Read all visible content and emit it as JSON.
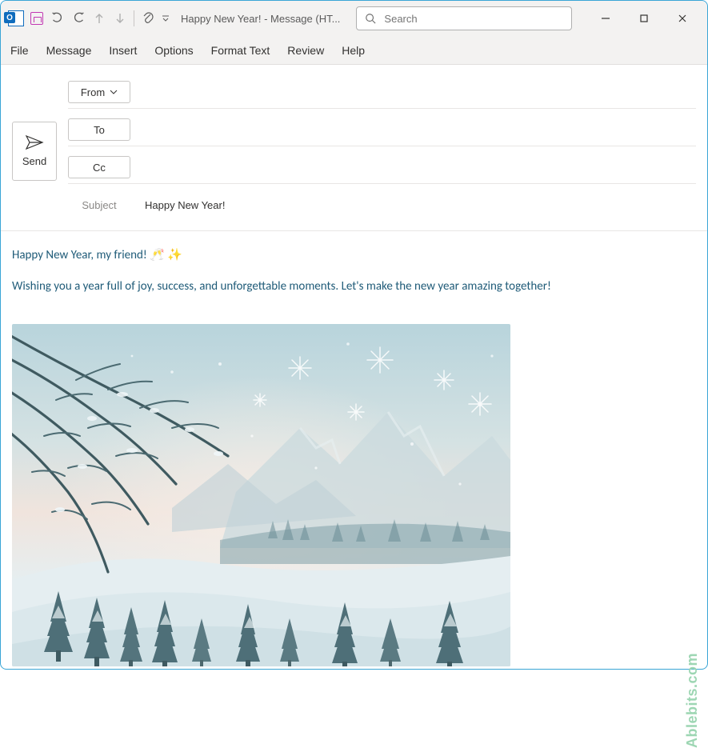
{
  "window": {
    "doc_title": "Happy New Year!  -  Message (HT..."
  },
  "search": {
    "placeholder": "Search"
  },
  "ribbon": {
    "tabs": {
      "file": "File",
      "message": "Message",
      "insert": "Insert",
      "options": "Options",
      "format_text": "Format Text",
      "review": "Review",
      "help": "Help"
    }
  },
  "compose": {
    "send_label": "Send",
    "from_label": "From",
    "to_label": "To",
    "cc_label": "Cc",
    "subject_label": "Subject",
    "subject_value": "Happy New Year!",
    "from_value": "",
    "to_value": "",
    "cc_value": ""
  },
  "body": {
    "line1": "Happy New Year, my friend! 🥂 ✨",
    "line2": "Wishing you a year full of joy, success, and unforgettable moments. Let's make the new year amazing together!"
  },
  "watermark": "Ablebits.com"
}
